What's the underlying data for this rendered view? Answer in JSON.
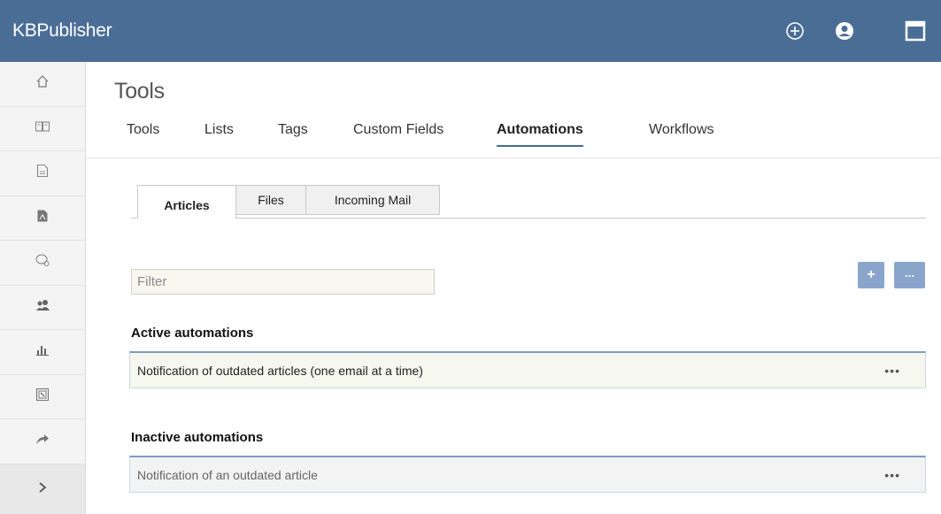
{
  "app": {
    "title": "KBPublisher"
  },
  "header_icons": [
    "add-circle-icon",
    "user-account-icon",
    "window-icon"
  ],
  "sidebar": {
    "items": [
      {
        "name": "home-icon"
      },
      {
        "name": "book-icon"
      },
      {
        "name": "document-icon"
      },
      {
        "name": "pdf-file-icon"
      },
      {
        "name": "comments-icon"
      },
      {
        "name": "users-icon"
      },
      {
        "name": "reports-chart-icon"
      },
      {
        "name": "import-export-icon"
      },
      {
        "name": "share-arrow-icon"
      }
    ],
    "expander": "›"
  },
  "page": {
    "title": "Tools"
  },
  "main_tabs": {
    "tools": "Tools",
    "lists": "Lists",
    "tags": "Tags",
    "custom_fields": "Custom Fields",
    "automations": "Automations",
    "workflows": "Workflows",
    "active": "Automations"
  },
  "sub_tabs": {
    "articles": "Articles",
    "files": "Files",
    "incoming_mail": "Incoming Mail",
    "active": "Articles"
  },
  "filter": {
    "placeholder": "Filter",
    "value": ""
  },
  "actions": {
    "add_label": "+",
    "more_label": "..."
  },
  "active_section": {
    "heading": "Active automations",
    "rows": [
      {
        "title": "Notification of outdated articles (one email at a time)",
        "menu": "•••"
      }
    ]
  },
  "inactive_section": {
    "heading": "Inactive automations",
    "rows": [
      {
        "title": "Notification of an outdated article",
        "menu": "•••"
      }
    ]
  },
  "colors": {
    "header_bg": "#4a6d96",
    "accent": "#4a6d96",
    "button_bg": "#8aa5cc"
  }
}
